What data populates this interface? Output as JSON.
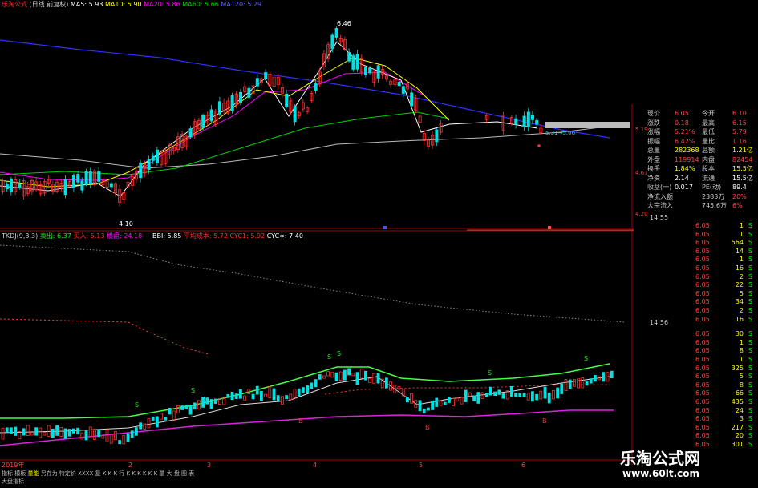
{
  "colors": {
    "up": "#ff3030",
    "down": "#00e0e0",
    "ma5": "#ffffff",
    "ma10": "#ffff00",
    "ma20": "#ff00ff",
    "ma60": "#00d000",
    "ma120": "#3030ff",
    "grid": "#8b0000",
    "panel_line": "#a00000"
  },
  "header": {
    "stock": "乐淘公式",
    "period": "(日线 前复权)",
    "ma5": "MA5: 5.93",
    "ma10": "MA10: 5.90",
    "ma20": "MA20: 5.86",
    "ma60": "MA60: 5.66",
    "ma120": "MA120: 5.29"
  },
  "price_marks": {
    "high": "6.46",
    "low": "4.10",
    "last_arrow": "5.31→5.06"
  },
  "indicator_header": {
    "title": "TKDJ(9,3,3)",
    "sell": "卖出: 6.37",
    "buy": "买入: 5.13",
    "neutral": "横盘: 24.18",
    "bbi": "BBI: 5.85",
    "avg_cost": "平均成本: 5.72",
    "cyc1": "CYC1: 5.92",
    "cyc_inf": "CYC∞: 7.40"
  },
  "signal_marks": {
    "s": "S",
    "b": "B"
  },
  "x_axis": {
    "year": "2019年",
    "months": [
      "2",
      "3",
      "4",
      "5",
      "6"
    ]
  },
  "right_axis": [
    "5.19",
    "4.67",
    "4.20"
  ],
  "quote": {
    "rows": [
      {
        "k1": "现价",
        "v1": "6.05",
        "k2": "今开",
        "v2": "6.10"
      },
      {
        "k1": "涨跌",
        "v1": "0.18",
        "k2": "最高",
        "v2": "6.15"
      },
      {
        "k1": "涨幅",
        "v1": "5.21%",
        "k2": "最低",
        "v2": "5.79"
      },
      {
        "k1": "振幅",
        "v1": "6.42%",
        "k2": "量比",
        "v2": "1.16"
      },
      {
        "k1": "总量",
        "v1": "282368",
        "k2": "总额",
        "v2": "1.21亿"
      },
      {
        "k1": "外盘",
        "v1": "119914",
        "k2": "内盘",
        "v2": "82454"
      },
      {
        "k1": "换手",
        "v1": "1.84%",
        "k2": "股本",
        "v2": "15.5亿"
      },
      {
        "k1": "净资",
        "v1": "2.14",
        "k2": "流通",
        "v2": "15.5亿"
      },
      {
        "k1": "收益(一)",
        "v1": "0.017",
        "k2": "PE(动)",
        "v2": "89.4"
      },
      {
        "k1": "净流入额",
        "v1": "",
        "k2": "2383万",
        "v2": "20%"
      },
      {
        "k1": "大宗流入",
        "v1": "",
        "k2": "745.6万",
        "v2": "6%"
      }
    ]
  },
  "ticks": {
    "time1": "14:55",
    "time2": "14:56",
    "rows": [
      {
        "p": "6.05",
        "v": "1",
        "t": "S"
      },
      {
        "p": "6.05",
        "v": "1",
        "t": "S"
      },
      {
        "p": "6.05",
        "v": "564",
        "t": "S"
      },
      {
        "p": "6.05",
        "v": "14",
        "t": "S"
      },
      {
        "p": "6.05",
        "v": "1",
        "t": "S"
      },
      {
        "p": "6.05",
        "v": "16",
        "t": "S"
      },
      {
        "p": "6.05",
        "v": "2",
        "t": "S"
      },
      {
        "p": "6.05",
        "v": "22",
        "t": "S"
      },
      {
        "p": "6.05",
        "v": "5",
        "t": "S"
      },
      {
        "p": "6.05",
        "v": "34",
        "t": "S"
      },
      {
        "p": "6.05",
        "v": "2",
        "t": "S"
      },
      {
        "p": "6.05",
        "v": "16",
        "t": "S"
      },
      {
        "p": "6.05",
        "v": "30",
        "t": "S"
      },
      {
        "p": "6.05",
        "v": "1",
        "t": "S"
      },
      {
        "p": "6.05",
        "v": "8",
        "t": "S"
      },
      {
        "p": "6.05",
        "v": "1",
        "t": "S"
      },
      {
        "p": "6.05",
        "v": "325",
        "t": "S"
      },
      {
        "p": "6.05",
        "v": "5",
        "t": "S"
      },
      {
        "p": "6.05",
        "v": "8",
        "t": "S"
      },
      {
        "p": "6.05",
        "v": "66",
        "t": "S"
      },
      {
        "p": "6.05",
        "v": "435",
        "t": "S"
      },
      {
        "p": "6.05",
        "v": "24",
        "t": "S"
      },
      {
        "p": "6.05",
        "v": "3",
        "t": "S"
      },
      {
        "p": "6.05",
        "v": "217",
        "t": "S"
      },
      {
        "p": "6.05",
        "v": "20",
        "t": "S"
      },
      {
        "p": "6.05",
        "v": "301",
        "t": "S"
      }
    ]
  },
  "bottom_tabs": [
    "指标",
    "模板",
    "量能",
    "另存为",
    "特定价",
    "XXXX",
    "复 K K K 行 K K K K K K 量 大 盘 图 表"
  ],
  "bottom_sub": "大盘指标",
  "watermark": {
    "title": "乐淘公式网",
    "url": "www.60lt.com"
  }
}
